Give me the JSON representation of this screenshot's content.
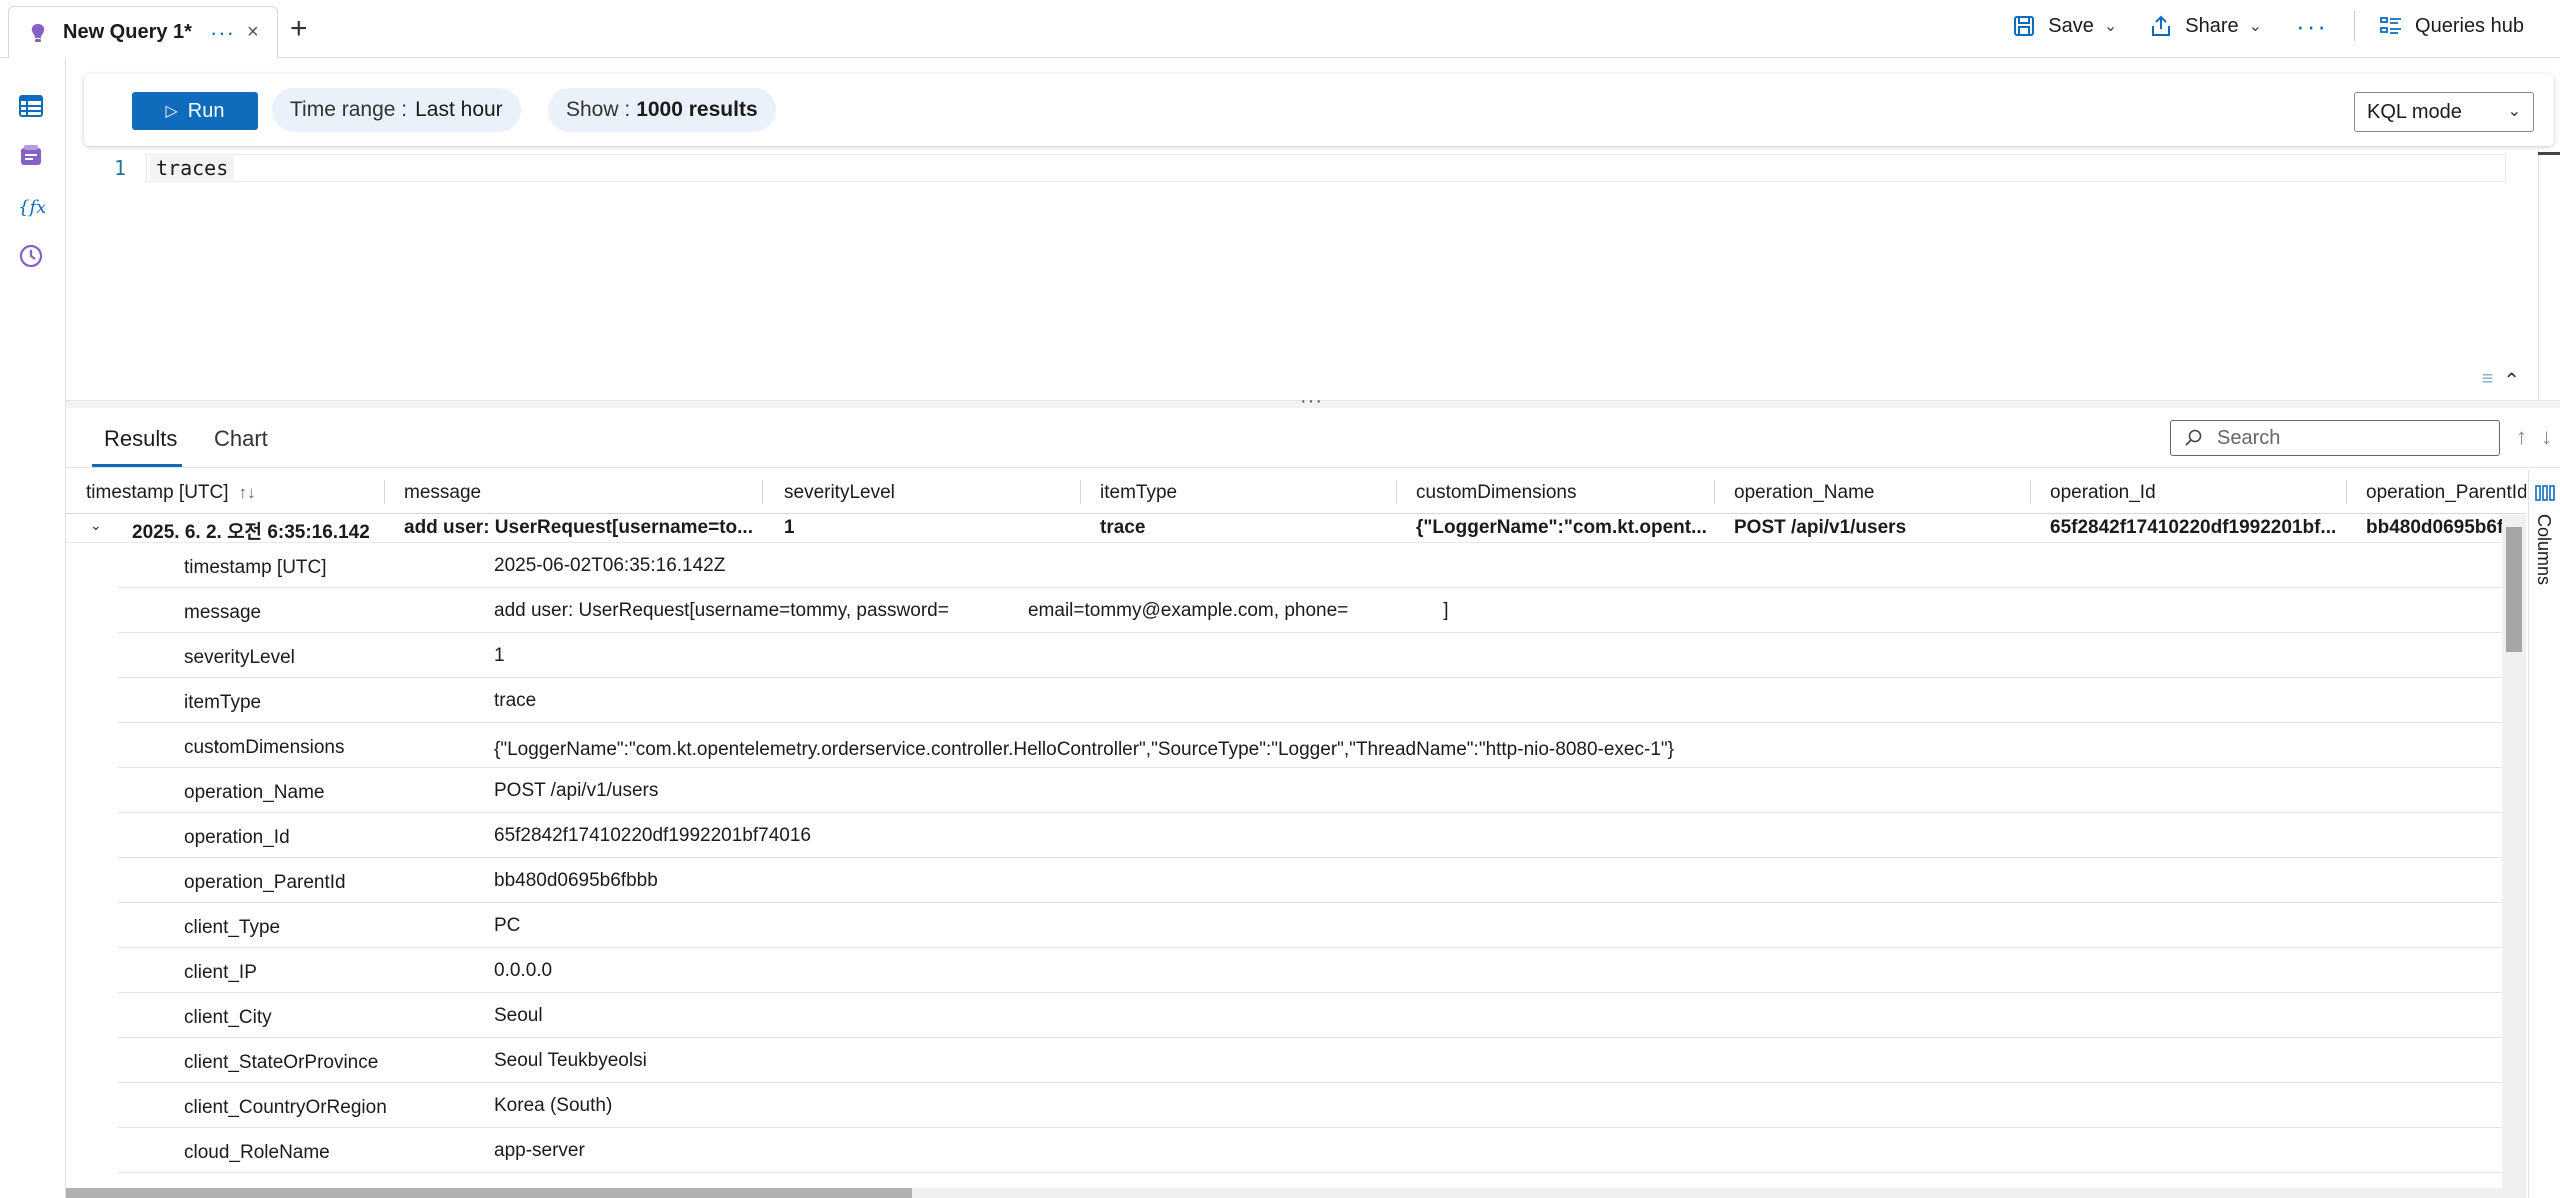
{
  "tab": {
    "title": "New Query 1*",
    "more": "···",
    "close": "×",
    "new_tab": "+"
  },
  "toolbar": {
    "save_label": "Save",
    "share_label": "Share",
    "more": "···",
    "queries_hub_label": "Queries hub"
  },
  "query_bar": {
    "run_label": "Run",
    "time_range_label": "Time range :",
    "time_range_value": "Last hour",
    "show_label": "Show :",
    "show_value": "1000 results",
    "mode_label": "KQL mode"
  },
  "editor": {
    "line_number": "1",
    "code": "traces"
  },
  "results_tabs": {
    "results": "Results",
    "chart": "Chart",
    "search_placeholder": "Search"
  },
  "columns_panel_label": "Columns",
  "grid": {
    "headers": [
      "timestamp [UTC]",
      "message",
      "severityLevel",
      "itemType",
      "customDimensions",
      "operation_Name",
      "operation_Id",
      "operation_ParentId"
    ],
    "summary_row": [
      "2025. 6. 2. 오전 6:35:16.142",
      "add user: UserRequest[username=to...",
      "1",
      "trace",
      "{\"LoggerName\":\"com.kt.opent...",
      "POST /api/v1/users",
      "65f2842f17410220df1992201bf...",
      "bb480d0695b6f"
    ],
    "details": [
      {
        "key": "timestamp [UTC]",
        "value": "2025-06-02T06:35:16.142Z"
      },
      {
        "key": "message",
        "value": "add user: UserRequest[username=tommy, password=               email=tommy@example.com, phone=                  ]"
      },
      {
        "key": "severityLevel",
        "value": "1"
      },
      {
        "key": "itemType",
        "value": "trace"
      },
      {
        "key": "customDimensions",
        "value": "{\"LoggerName\":\"com.kt.opentelemetry.orderservice.controller.HelloController\",\"SourceType\":\"Logger\",\"ThreadName\":\"http-nio-8080-exec-1\"}"
      },
      {
        "key": "operation_Name",
        "value": "POST /api/v1/users"
      },
      {
        "key": "operation_Id",
        "value": "65f2842f17410220df1992201bf74016"
      },
      {
        "key": "operation_ParentId",
        "value": "bb480d0695b6fbbb"
      },
      {
        "key": "client_Type",
        "value": "PC"
      },
      {
        "key": "client_IP",
        "value": "0.0.0.0"
      },
      {
        "key": "client_City",
        "value": "Seoul"
      },
      {
        "key": "client_StateOrProvince",
        "value": "Seoul Teukbyeolsi"
      },
      {
        "key": "client_CountryOrRegion",
        "value": "Korea (South)"
      },
      {
        "key": "cloud_RoleName",
        "value": "app-server"
      }
    ]
  },
  "colors": {
    "accent": "#0f6cbd",
    "pill_bg": "#eaf1fb"
  }
}
